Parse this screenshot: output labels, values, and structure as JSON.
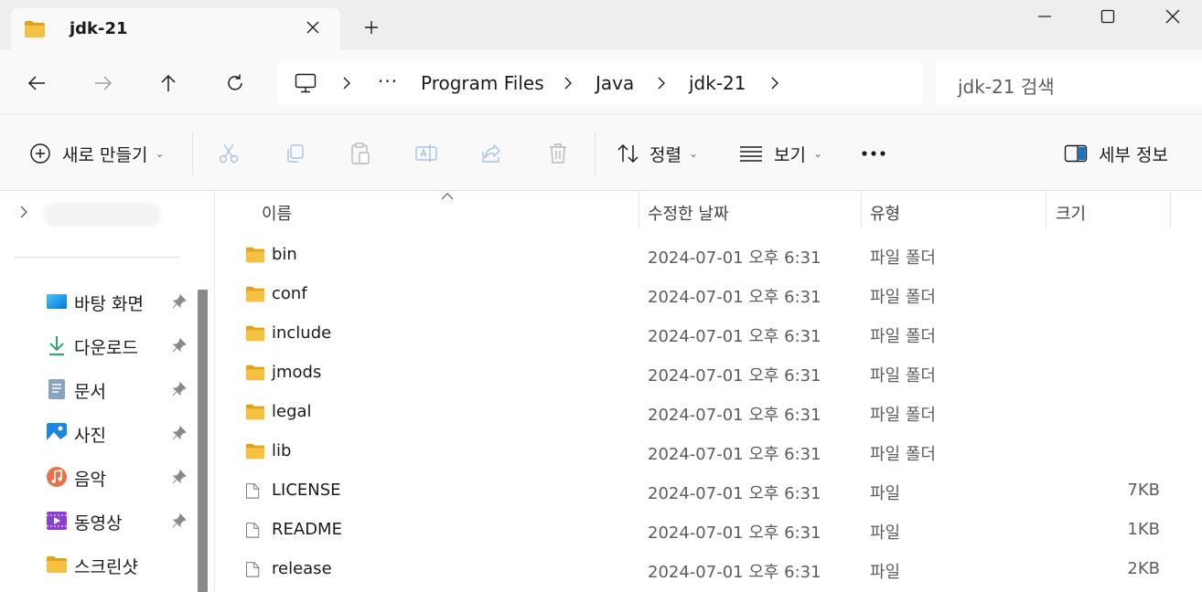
{
  "window": {
    "tab_title": "jdk-21",
    "new_tab": "+",
    "buttons": [
      "minimize",
      "maximize",
      "close"
    ]
  },
  "nav": {
    "breadcrumb": [
      "Program Files",
      "Java",
      "jdk-21"
    ],
    "ellipsis": "···",
    "search_placeholder": "jdk-21 검색"
  },
  "toolbar": {
    "new_label": "새로 만들기",
    "sort_label": "정렬",
    "view_label": "보기",
    "more_label": "···",
    "details_label": "세부 정보"
  },
  "sidebar": {
    "items": [
      {
        "label": "바탕 화면",
        "icon": "desktop-icon",
        "pinned": true
      },
      {
        "label": "다운로드",
        "icon": "download-icon",
        "pinned": true
      },
      {
        "label": "문서",
        "icon": "documents-icon",
        "pinned": true
      },
      {
        "label": "사진",
        "icon": "pictures-icon",
        "pinned": true
      },
      {
        "label": "음악",
        "icon": "music-icon",
        "pinned": true
      },
      {
        "label": "동영상",
        "icon": "videos-icon",
        "pinned": true
      },
      {
        "label": "스크린샷",
        "icon": "folder-icon",
        "pinned": false
      }
    ]
  },
  "columns": {
    "name": "이름",
    "modified": "수정한 날짜",
    "type": "유형",
    "size": "크기"
  },
  "files": [
    {
      "name": "bin",
      "modified": "2024-07-01 오후 6:31",
      "type": "파일 폴더",
      "size": "",
      "kind": "folder"
    },
    {
      "name": "conf",
      "modified": "2024-07-01 오후 6:31",
      "type": "파일 폴더",
      "size": "",
      "kind": "folder"
    },
    {
      "name": "include",
      "modified": "2024-07-01 오후 6:31",
      "type": "파일 폴더",
      "size": "",
      "kind": "folder"
    },
    {
      "name": "jmods",
      "modified": "2024-07-01 오후 6:31",
      "type": "파일 폴더",
      "size": "",
      "kind": "folder"
    },
    {
      "name": "legal",
      "modified": "2024-07-01 오후 6:31",
      "type": "파일 폴더",
      "size": "",
      "kind": "folder"
    },
    {
      "name": "lib",
      "modified": "2024-07-01 오후 6:31",
      "type": "파일 폴더",
      "size": "",
      "kind": "folder"
    },
    {
      "name": "LICENSE",
      "modified": "2024-07-01 오후 6:31",
      "type": "파일",
      "size": "7KB",
      "kind": "file"
    },
    {
      "name": "README",
      "modified": "2024-07-01 오후 6:31",
      "type": "파일",
      "size": "1KB",
      "kind": "file"
    },
    {
      "name": "release",
      "modified": "2024-07-01 오후 6:31",
      "type": "파일",
      "size": "2KB",
      "kind": "file"
    }
  ],
  "colors": {
    "folder_yellow": "#f6c142",
    "folder_dark": "#e3a21a",
    "titlebar_bg": "#eeeeee",
    "panel_bg": "#f9f9f9",
    "accent": "#0067c0"
  }
}
